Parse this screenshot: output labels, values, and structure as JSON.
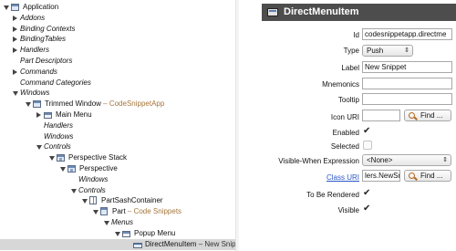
{
  "tree": [
    {
      "label": "Application",
      "suffix": "",
      "italic": false,
      "toggle": "expanded",
      "icon": "application-icon"
    },
    {
      "label": "Addons",
      "suffix": "",
      "italic": true,
      "toggle": "collapsed",
      "icon": ""
    },
    {
      "label": "Binding Contexts",
      "suffix": "",
      "italic": true,
      "toggle": "collapsed",
      "icon": ""
    },
    {
      "label": "BindingTables",
      "suffix": "",
      "italic": true,
      "toggle": "collapsed",
      "icon": ""
    },
    {
      "label": "Handlers",
      "suffix": "",
      "italic": true,
      "toggle": "collapsed",
      "icon": ""
    },
    {
      "label": "Part Descriptors",
      "suffix": "",
      "italic": true,
      "toggle": "none",
      "icon": ""
    },
    {
      "label": "Commands",
      "suffix": "",
      "italic": true,
      "toggle": "collapsed",
      "icon": ""
    },
    {
      "label": "Command Categories",
      "suffix": "",
      "italic": true,
      "toggle": "none",
      "icon": ""
    },
    {
      "label": "Windows",
      "suffix": "",
      "italic": true,
      "toggle": "expanded",
      "icon": ""
    },
    {
      "label": "Trimmed Window",
      "suffix": " – CodeSnippetApp",
      "italic": false,
      "toggle": "expanded",
      "icon": "window-icon"
    },
    {
      "label": "Main Menu",
      "suffix": "",
      "italic": false,
      "toggle": "collapsed",
      "icon": "menu-icon"
    },
    {
      "label": "Handlers",
      "suffix": "",
      "italic": true,
      "toggle": "none",
      "icon": ""
    },
    {
      "label": "Windows",
      "suffix": "",
      "italic": true,
      "toggle": "none",
      "icon": ""
    },
    {
      "label": "Controls",
      "suffix": "",
      "italic": true,
      "toggle": "expanded",
      "icon": ""
    },
    {
      "label": "Perspective Stack",
      "suffix": "",
      "italic": false,
      "toggle": "expanded",
      "icon": "perspective-stack-icon"
    },
    {
      "label": "Perspective",
      "suffix": "",
      "italic": false,
      "toggle": "expanded",
      "icon": "perspective-icon"
    },
    {
      "label": "Windows",
      "suffix": "",
      "italic": true,
      "toggle": "none",
      "icon": ""
    },
    {
      "label": "Controls",
      "suffix": "",
      "italic": true,
      "toggle": "expanded",
      "icon": ""
    },
    {
      "label": "PartSashContainer",
      "suffix": "",
      "italic": false,
      "toggle": "expanded",
      "icon": "sash-container-icon"
    },
    {
      "label": "Part",
      "suffix": " – Code Snippets",
      "italic": false,
      "toggle": "expanded",
      "icon": "part-icon"
    },
    {
      "label": "Menus",
      "suffix": "",
      "italic": true,
      "toggle": "expanded",
      "icon": ""
    },
    {
      "label": "Popup Menu",
      "suffix": "",
      "italic": false,
      "toggle": "expanded",
      "icon": "popup-menu-icon"
    },
    {
      "label": "DirectMenuItem",
      "suffix": " – New Snippet",
      "italic": false,
      "toggle": "none",
      "icon": "menu-item-icon",
      "selected": true
    }
  ],
  "detail": {
    "title": "DirectMenuItem",
    "fields": {
      "id_label": "Id",
      "id_value": "codesnippetapp.directme",
      "type_label": "Type",
      "type_value": "Push",
      "label_label": "Label",
      "label_value": "New Snippet",
      "mnemonics_label": "Mnemonics",
      "mnemonics_value": "",
      "tooltip_label": "Tooltip",
      "tooltip_value": "",
      "icon_uri_label": "Icon URI",
      "icon_uri_value": "",
      "find_label": "Find ...",
      "enabled_label": "Enabled",
      "enabled_checked": true,
      "selected_label": "Selected",
      "selected_checked": false,
      "visible_when_label": "Visible-When Expression",
      "visible_when_value": "<None>",
      "class_uri_label": "Class URI",
      "class_uri_value": "lers.NewSr",
      "to_be_rendered_label": "To Be Rendered",
      "to_be_rendered_checked": true,
      "visible_label": "Visible",
      "visible_checked": true
    }
  }
}
